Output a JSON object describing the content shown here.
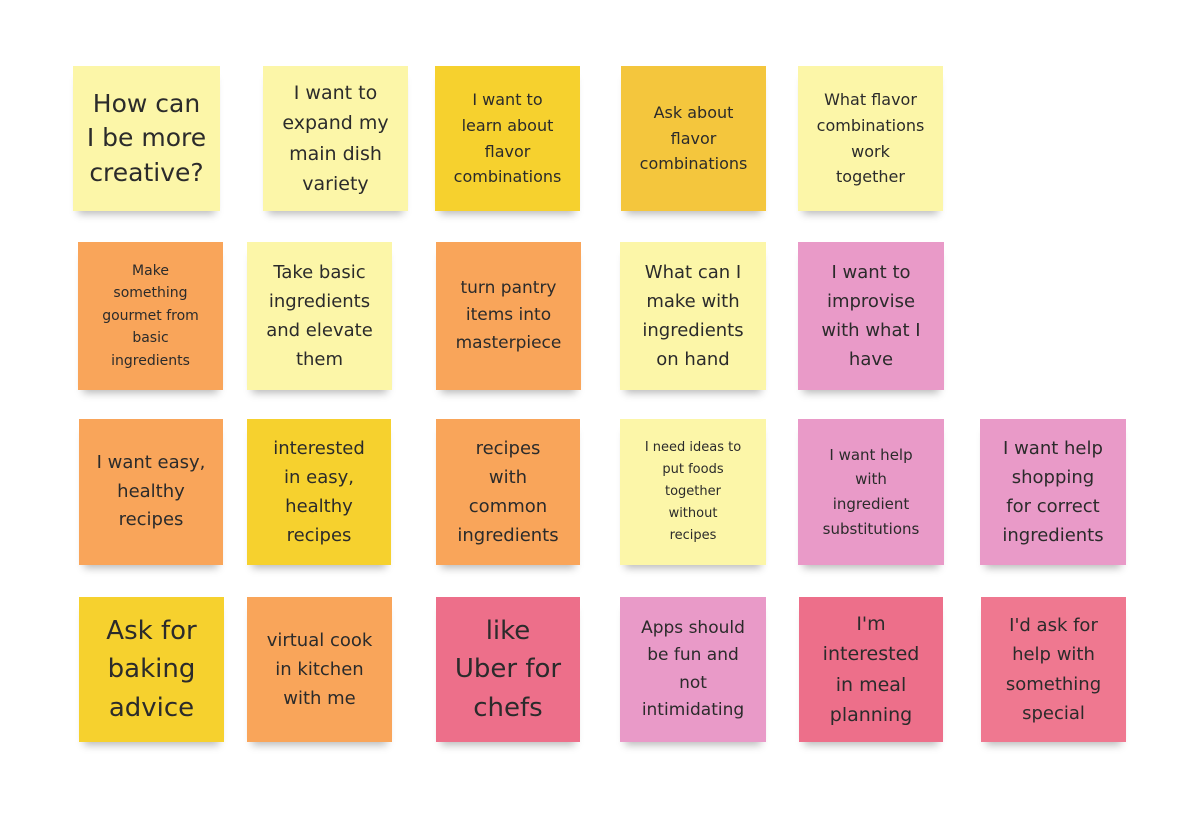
{
  "notes": [
    {
      "text": "How can\nI be more\ncreative?",
      "color": "#fcf6a8"
    },
    {
      "text": "I want to\nexpand my\nmain dish\nvariety",
      "color": "#fcf6a8"
    },
    {
      "text": "I want to\nlearn about\nflavor\ncombinations",
      "color": "#f6d12e"
    },
    {
      "text": "Ask about\nflavor\ncombinations",
      "color": "#f4c63d"
    },
    {
      "text": "What flavor\ncombinations\nwork\ntogether",
      "color": "#fcf6a8"
    },
    {
      "text": "Make\nsomething\ngourmet from\nbasic\ningredients",
      "color": "#f9a55a"
    },
    {
      "text": "Take basic\ningredients\nand elevate\nthem",
      "color": "#fcf6a8"
    },
    {
      "text": "turn pantry\nitems into\nmasterpiece",
      "color": "#f9a55a"
    },
    {
      "text": "What can I\nmake with\ningredients\non hand",
      "color": "#fcf6a8"
    },
    {
      "text": "I want to\nimprovise\nwith what I\nhave",
      "color": "#e99ac8"
    },
    {
      "text": "I want easy,\nhealthy\nrecipes",
      "color": "#f9a55a"
    },
    {
      "text": "interested\nin easy,\nhealthy\nrecipes",
      "color": "#f6d12e"
    },
    {
      "text": "recipes\nwith\ncommon\ningredients",
      "color": "#f9a55a"
    },
    {
      "text": "I need ideas to\nput foods\ntogether\nwithout\nrecipes",
      "color": "#fcf6a8"
    },
    {
      "text": "I want help\nwith\ningredient\nsubstitutions",
      "color": "#e99ac8"
    },
    {
      "text": "I want help\nshopping\nfor correct\ningredients",
      "color": "#e99ac8"
    },
    {
      "text": "Ask for\nbaking\nadvice",
      "color": "#f6d12e"
    },
    {
      "text": "virtual cook\nin kitchen\nwith me",
      "color": "#f9a55a"
    },
    {
      "text": "like\nUber for\nchefs",
      "color": "#ed6f8a"
    },
    {
      "text": "Apps should\nbe fun and\nnot\nintimidating",
      "color": "#e99ac8"
    },
    {
      "text": "I'm\ninterested\nin meal\nplanning",
      "color": "#ed6f8a"
    },
    {
      "text": "I'd ask for\nhelp with\nsomething\nspecial",
      "color": "#ef7890"
    }
  ]
}
